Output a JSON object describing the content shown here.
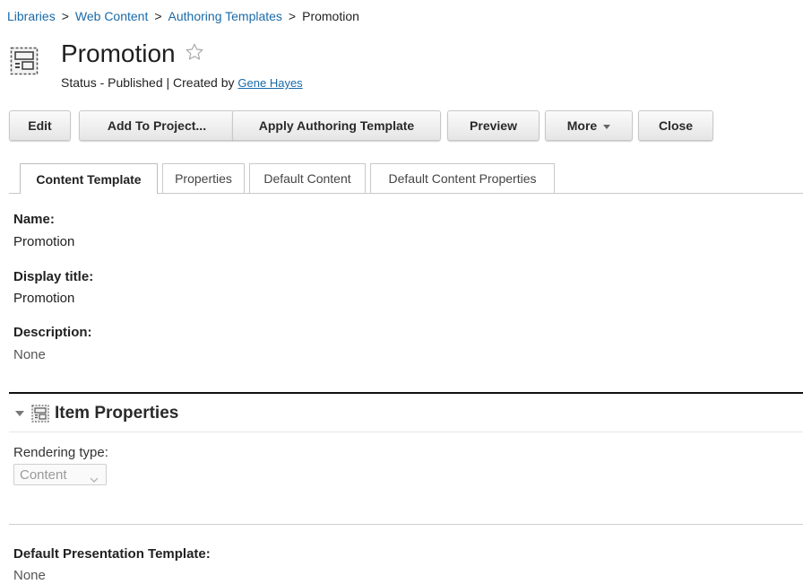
{
  "breadcrumb": {
    "items": [
      "Libraries",
      "Web Content",
      "Authoring Templates"
    ],
    "current": "Promotion",
    "separator": ">"
  },
  "header": {
    "icon": "template-icon",
    "title": "Promotion",
    "favorite_icon": "star-outline-icon",
    "status_prefix": "Status - Published | Created by",
    "creator": "Gene Hayes"
  },
  "toolbar": {
    "edit": "Edit",
    "add_to_project": "Add To Project...",
    "apply_authoring_template": "Apply Authoring Template",
    "preview": "Preview",
    "more": "More",
    "close": "Close"
  },
  "tabs": [
    {
      "label": "Content Template",
      "active": true
    },
    {
      "label": "Properties",
      "active": false
    },
    {
      "label": "Default Content",
      "active": false
    },
    {
      "label": "Default Content Properties",
      "active": false
    }
  ],
  "fields": {
    "name_label": "Name:",
    "name_value": "Promotion",
    "display_title_label": "Display title:",
    "display_title_value": "Promotion",
    "description_label": "Description:",
    "description_value": "None"
  },
  "item_properties": {
    "title": "Item Properties",
    "icon": "item-properties-icon",
    "rendering_type_label": "Rendering type:",
    "rendering_type_value": "Content",
    "default_presentation_label": "Default Presentation Template:",
    "default_presentation_value": "None"
  },
  "colors": {
    "link": "#1a6aa8",
    "section_rule": "#111111"
  }
}
